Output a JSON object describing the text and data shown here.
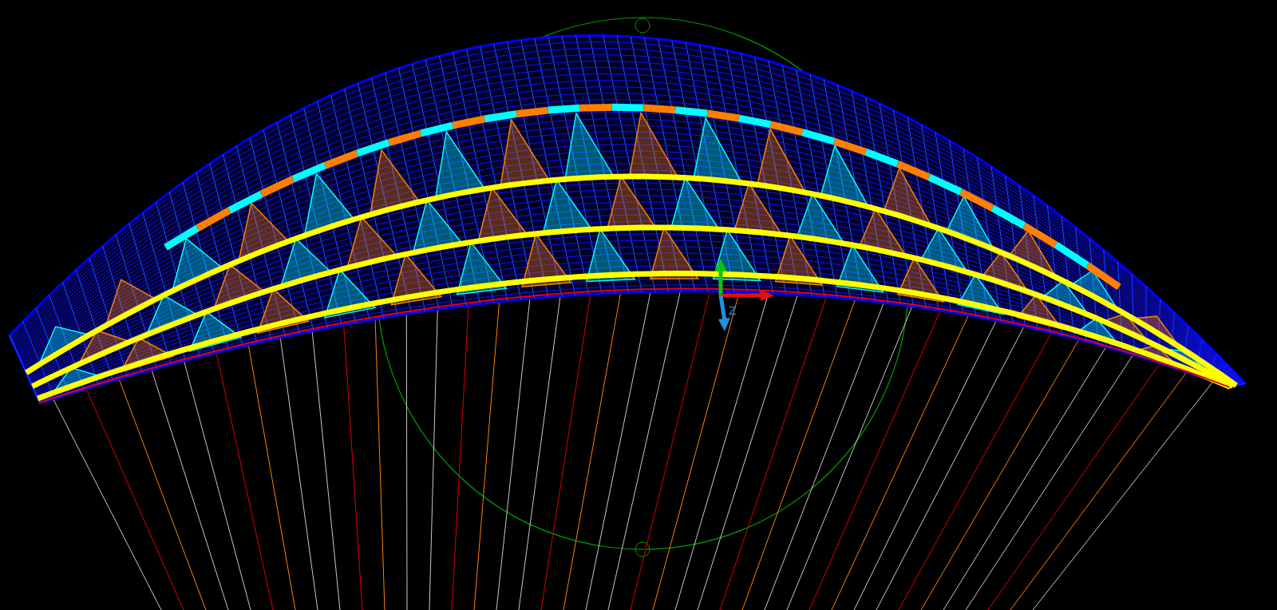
{
  "viewport": {
    "gizmo": {
      "z_label": "Z"
    }
  }
}
